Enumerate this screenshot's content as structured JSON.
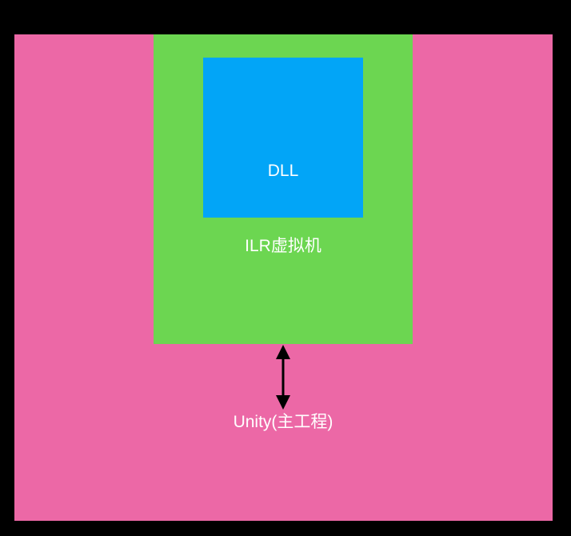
{
  "colors": {
    "background": "#000000",
    "unity": "#ec68a6",
    "ilr": "#6cd651",
    "dll": "#02a5f7",
    "text": "#ffffff",
    "arrow": "#000000"
  },
  "diagram": {
    "dll_label": "DLL",
    "ilr_label": "ILR虚拟机",
    "unity_label": "Unity(主工程)"
  }
}
